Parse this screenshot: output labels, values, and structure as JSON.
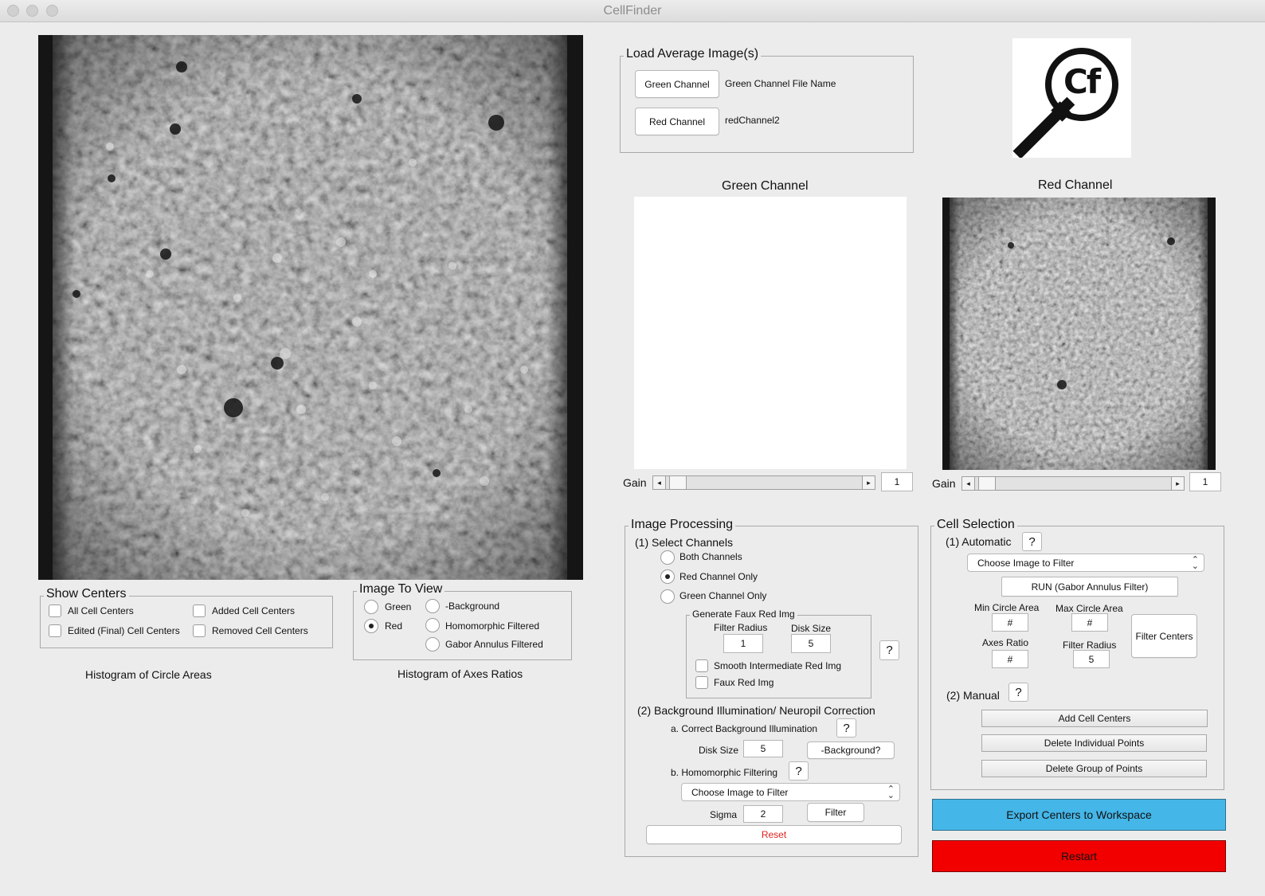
{
  "window": {
    "title": "CellFinder"
  },
  "logo": {
    "text": "Cf"
  },
  "load_images": {
    "title": "Load Average Image(s)",
    "green_button": "Green Channel",
    "green_file": "Green Channel File Name",
    "red_button": "Red Channel",
    "red_file": "redChannel2"
  },
  "green_panel": {
    "title": "Green Channel",
    "gain_label": "Gain",
    "gain_value": "1",
    "gain_level": 0.0
  },
  "red_panel": {
    "title": "Red Channel",
    "gain_label": "Gain",
    "gain_value": "1",
    "gain_level": 0.0
  },
  "show_centers": {
    "title": "Show Centers",
    "items": [
      {
        "label": "All Cell Centers",
        "checked": false
      },
      {
        "label": "Added Cell Centers",
        "checked": false
      },
      {
        "label": "Edited (Final) Cell Centers",
        "checked": false
      },
      {
        "label": "Removed Cell Centers",
        "checked": false
      }
    ]
  },
  "image_to_view": {
    "title": "Image To View",
    "options": [
      "Green",
      "Red",
      "-Background",
      "Homomorphic Filtered",
      "Gabor Annulus Filtered"
    ],
    "selected": "Red"
  },
  "histograms": {
    "circle_areas": "Histogram of Circle Areas",
    "axes_ratios": "Histogram of Axes Ratios"
  },
  "image_processing": {
    "title": "Image Processing",
    "select_channels": "(1) Select Channels",
    "channel_options": [
      "Both Channels",
      "Red Channel Only",
      "Green Channel Only"
    ],
    "channel_selected": "Red Channel Only",
    "faux": {
      "title": "Generate Faux Red Img",
      "filter_radius_label": "Filter Radius",
      "filter_radius": "1",
      "disk_size_label": "Disk Size",
      "disk_size": "5",
      "help": "?",
      "smooth_label": "Smooth Intermediate Red Img",
      "faux_label": "Faux Red Img"
    },
    "bg_title": "(2) Background Illumination/ Neuropil Correction",
    "correct_bg": "a.  Correct Background Illumination",
    "help": "?",
    "disk_size_label": "Disk Size",
    "disk_size": "5",
    "bg_button": "-Background?",
    "homomorphic": "b.  Homomorphic Filtering",
    "choose_placeholder": "Choose Image to Filter",
    "sigma_label": "Sigma",
    "sigma": "2",
    "filter_button": "Filter",
    "reset_button": "Reset"
  },
  "cell_selection": {
    "title": "Cell Selection",
    "automatic": "(1) Automatic",
    "help": "?",
    "choose_placeholder": "Choose Image to Filter",
    "run_button": "RUN (Gabor Annulus Filter)",
    "min_area_label": "Min Circle Area",
    "min_area": "#",
    "max_area_label": "Max Circle Area",
    "max_area": "#",
    "axes_ratio_label": "Axes Ratio",
    "axes_ratio": "#",
    "filter_radius_label": "Filter Radius",
    "filter_radius": "5",
    "filter_centers_button": "Filter Centers",
    "manual": "(2) Manual",
    "add_button": "Add Cell Centers",
    "delete_points_button": "Delete Individual Points",
    "delete_group_button": "Delete Group of Points"
  },
  "export_button": "Export Centers to Workspace",
  "restart_button": "Restart",
  "colors": {
    "export": "#45b6e8",
    "restart": "#f20000",
    "reset_text": "#e02020"
  }
}
